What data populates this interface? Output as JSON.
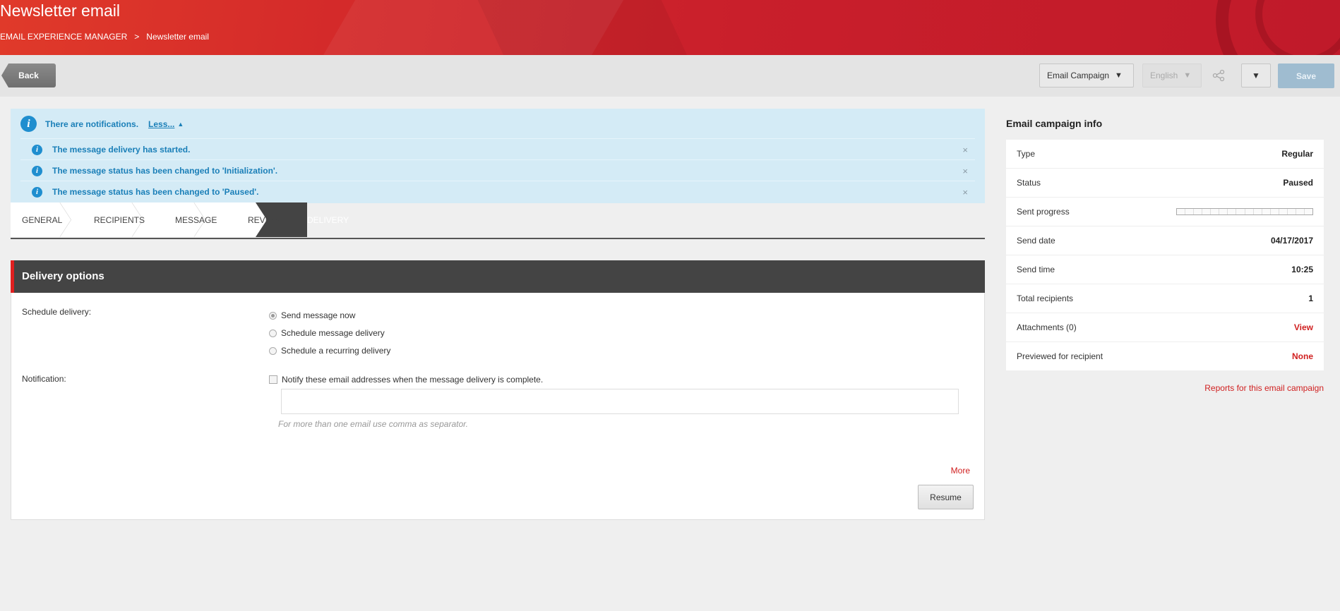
{
  "header": {
    "title": "Newsletter email",
    "breadcrumb": [
      "EMAIL EXPERIENCE MANAGER",
      "Newsletter email"
    ],
    "breadcrumb_sep": ">"
  },
  "toolbar": {
    "back_label": "Back",
    "campaign_label": "Email Campaign",
    "language_label": "English",
    "save_label": "Save"
  },
  "notifications": {
    "summary": "There are notifications.",
    "toggle_label": "Less...",
    "items": [
      "The message delivery has started.",
      "The message status has been changed to 'Initialization'.",
      "The message status has been changed to 'Paused'."
    ],
    "close_label": "×"
  },
  "tabs": [
    "GENERAL",
    "RECIPIENTS",
    "MESSAGE",
    "REVIEW",
    "DELIVERY"
  ],
  "active_tab": "DELIVERY",
  "delivery": {
    "title": "Delivery options",
    "schedule_label": "Schedule delivery:",
    "schedule_options": [
      "Send message now",
      "Schedule message delivery",
      "Schedule a recurring delivery"
    ],
    "selected_option": "Send message now",
    "notification_label": "Notification:",
    "notify_text": "Notify these email addresses when the message delivery is complete.",
    "notify_checked": false,
    "email_value": "",
    "hint": "For more than one email use comma as separator.",
    "more_label": "More",
    "resume_label": "Resume"
  },
  "campaign_info": {
    "title": "Email campaign info",
    "rows": [
      {
        "key": "Type",
        "value": "Regular"
      },
      {
        "key": "Status",
        "value": "Paused"
      },
      {
        "key": "Sent progress",
        "value": ""
      },
      {
        "key": "Send date",
        "value": "04/17/2017"
      },
      {
        "key": "Send time",
        "value": "10:25"
      },
      {
        "key": "Total recipients",
        "value": "1"
      },
      {
        "key": "Attachments (0)",
        "value": "View"
      },
      {
        "key": "Previewed for recipient",
        "value": "None"
      }
    ],
    "sent_progress": 0,
    "reports_link": "Reports for this email campaign"
  },
  "colors": {
    "brand_red": "#d02020",
    "info_blue": "#1f8ecf",
    "notification_bg": "#d4ebf6",
    "save_disabled": "#9fbcd0"
  }
}
